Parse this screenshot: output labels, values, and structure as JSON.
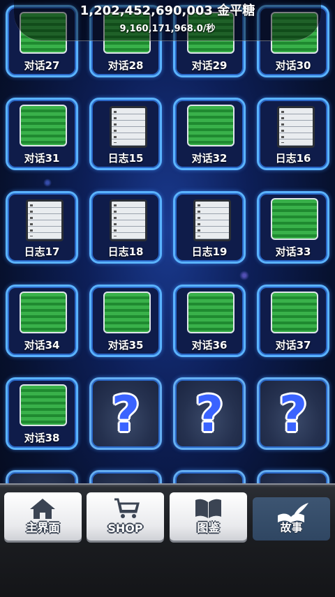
{
  "header": {
    "total": "1,202,452,690,003 金平糖",
    "rate": "9,160,171,968.0/秒"
  },
  "tiles": [
    {
      "label": "对话27",
      "kind": "dialogue"
    },
    {
      "label": "对话28",
      "kind": "dialogue"
    },
    {
      "label": "对话29",
      "kind": "dialogue"
    },
    {
      "label": "对话30",
      "kind": "dialogue"
    },
    {
      "label": "对话31",
      "kind": "dialogue"
    },
    {
      "label": "日志15",
      "kind": "journal"
    },
    {
      "label": "对话32",
      "kind": "dialogue"
    },
    {
      "label": "日志16",
      "kind": "journal"
    },
    {
      "label": "日志17",
      "kind": "journal"
    },
    {
      "label": "日志18",
      "kind": "journal"
    },
    {
      "label": "日志19",
      "kind": "journal"
    },
    {
      "label": "对话33",
      "kind": "dialogue"
    },
    {
      "label": "对话34",
      "kind": "dialogue"
    },
    {
      "label": "对话35",
      "kind": "dialogue"
    },
    {
      "label": "对话36",
      "kind": "dialogue"
    },
    {
      "label": "对话37",
      "kind": "dialogue"
    },
    {
      "label": "对话38",
      "kind": "dialogue"
    },
    {
      "label": "?",
      "kind": "locked"
    },
    {
      "label": "?",
      "kind": "locked"
    },
    {
      "label": "?",
      "kind": "locked"
    }
  ],
  "nav": {
    "home": "主界面",
    "shop": "SHOP",
    "encyclopedia": "图鉴",
    "story": "故事"
  },
  "colors": {
    "tile_border": "#5ab3ff",
    "question_mark": "#3a63ff",
    "portrait_green": "#39b14a",
    "active_nav": "#3d5572"
  }
}
